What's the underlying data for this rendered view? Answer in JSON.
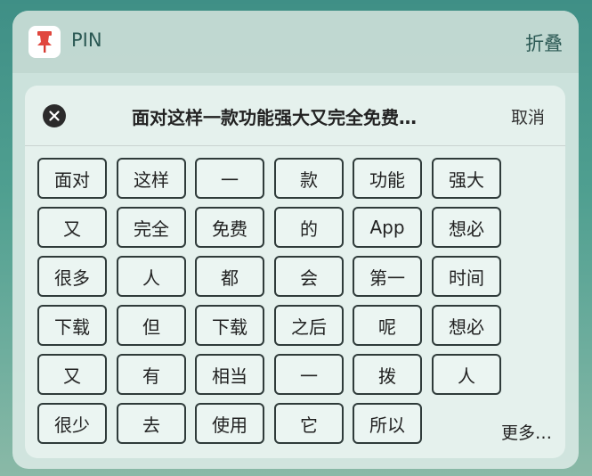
{
  "header": {
    "app_name": "PIN",
    "collapse_label": "折叠"
  },
  "card": {
    "title": "面对这样一款功能强大又完全免费…",
    "cancel_label": "取消"
  },
  "tokens": [
    [
      "面对",
      "这样",
      "一",
      "款",
      "功能",
      "强大"
    ],
    [
      "又",
      "完全",
      "免费",
      "的",
      "App",
      "想必"
    ],
    [
      "很多",
      "人",
      "都",
      "会",
      "第一",
      "时间"
    ],
    [
      "下载",
      "但",
      "下载",
      "之后",
      "呢",
      "想必"
    ],
    [
      "又",
      "有",
      "相当",
      "一",
      "拨",
      "人"
    ],
    [
      "很少",
      "去",
      "使用",
      "它",
      "所以"
    ]
  ],
  "more_label": "更多…",
  "icons": {
    "app": "pushpin-icon",
    "close": "close-icon"
  },
  "colors": {
    "pin_red": "#e0473e",
    "text_dark": "#222222"
  }
}
